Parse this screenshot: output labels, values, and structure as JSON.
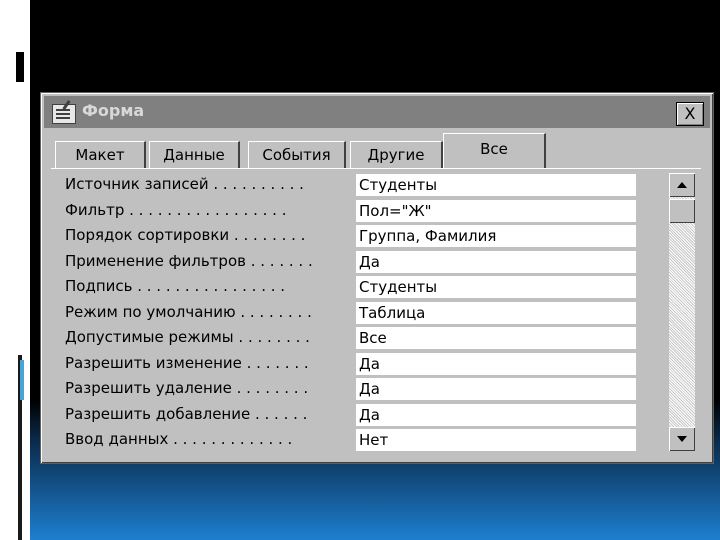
{
  "window": {
    "title": "Форма",
    "close_label": "X"
  },
  "tabs": [
    {
      "label": "Макет",
      "active": false
    },
    {
      "label": "Данные",
      "active": false
    },
    {
      "label": "События",
      "active": false
    },
    {
      "label": "Другие",
      "active": false
    },
    {
      "label": "Все",
      "active": true
    }
  ],
  "properties": [
    {
      "label": "Источник записей . . . . . . . . . .",
      "value": "Студенты"
    },
    {
      "label": "Фильтр . . . . . . . . . . . . . . . . .",
      "value": "Пол=\"Ж\""
    },
    {
      "label": "Порядок сортировки . . . . . . . .",
      "value": "Группа, Фамилия"
    },
    {
      "label": "Применение фильтров . . . . . . .",
      "value": "Да"
    },
    {
      "label": "Подпись . . . . . . . . . . . . . . . .",
      "value": "Студенты"
    },
    {
      "label": "Режим по умолчанию . . . . . . . .",
      "value": "Таблица"
    },
    {
      "label": "Допустимые режимы . . . . . . . .",
      "value": "Все"
    },
    {
      "label": "Разрешить изменение . . . . . . .",
      "value": "Да"
    },
    {
      "label": "Разрешить удаление . . . . . . . .",
      "value": "Да"
    },
    {
      "label": "Разрешить добавление . . . . . .",
      "value": "Да"
    },
    {
      "label": "Ввод данных . . . . . . . . . . . . .",
      "value": "Нет"
    }
  ],
  "icons": {
    "title": "form-properties-icon"
  }
}
